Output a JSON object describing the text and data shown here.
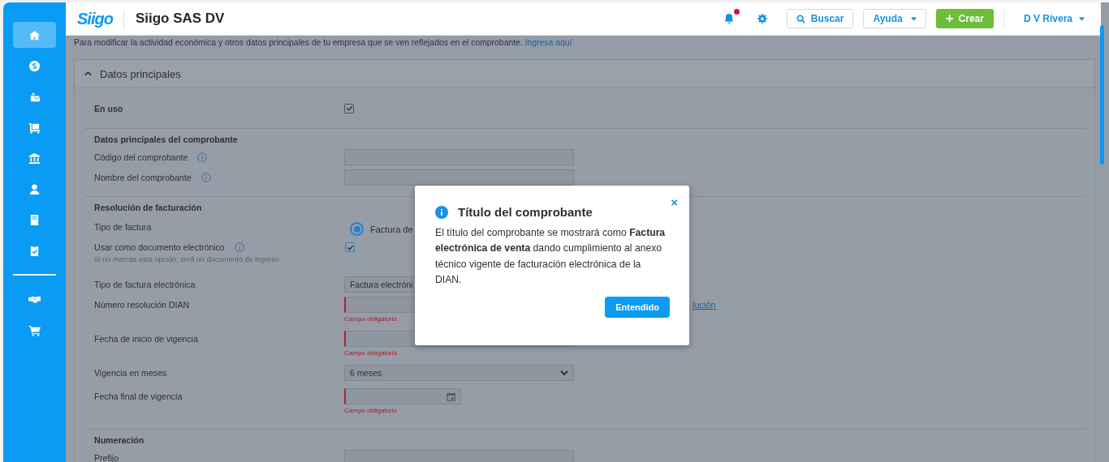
{
  "header": {
    "logo": "Siigo",
    "company": "Siigo SAS DV",
    "notifications": {
      "unread": true
    },
    "search_button": "Buscar",
    "help_button": "Ayuda",
    "create_button": "Crear",
    "create_icon": "+",
    "user": "D V Rivera"
  },
  "sidebar": {
    "main_items": [
      {
        "kind": "home",
        "selected": true
      },
      {
        "kind": "money",
        "selected": false
      },
      {
        "kind": "briefcase",
        "selected": false
      },
      {
        "kind": "dolly",
        "selected": false
      },
      {
        "kind": "bank",
        "selected": false
      },
      {
        "kind": "user",
        "selected": false
      },
      {
        "kind": "book",
        "selected": false
      },
      {
        "kind": "clipboard",
        "selected": false
      }
    ],
    "extra_items": [
      {
        "kind": "handshake",
        "selected": false
      },
      {
        "kind": "cart",
        "selected": false
      }
    ]
  },
  "notice": {
    "text": "Para modificar la actividad económica y otros datos principales de tu empresa que se ven reflejados en el comprobante.",
    "link": "Ingresa aquí"
  },
  "panel": {
    "title": "Datos principales",
    "expanded": true,
    "in_use": {
      "label": "En uso",
      "checked": true
    },
    "sections": [
      {
        "title": "Datos principales del comprobante",
        "rows": [
          {
            "kind": "input",
            "label": "Código del comprobante",
            "info": true
          },
          {
            "kind": "input",
            "label": "Nombre del comprobante",
            "info": true
          }
        ]
      },
      {
        "title": "Resolución de facturación",
        "rows": [
          {
            "kind": "radio",
            "label": "Tipo de factura",
            "option": "Factura de",
            "selected": true
          },
          {
            "kind": "checkbox",
            "label": "Usar como documento electrónico",
            "info": true,
            "hint": "Si no marcas esta opción, será un documento de ingreso",
            "checked": true
          },
          {
            "kind": "select",
            "label": "Tipo de factura electrónica",
            "value": "Factura electróni"
          },
          {
            "kind": "input",
            "label": "Número resolución DIAN",
            "error": "Campo obligatorio",
            "link": "lución"
          },
          {
            "kind": "input",
            "label": "Fecha de inicio de vigencia",
            "error": "Campo obligatorio"
          },
          {
            "kind": "select",
            "label": "Vigencia en meses",
            "value": "6 meses"
          },
          {
            "kind": "date",
            "label": "Fecha final de vigencia",
            "error": "Campo obligatorio"
          }
        ]
      },
      {
        "title": "Numeración",
        "rows": [
          {
            "kind": "input",
            "label": "Prefijo"
          }
        ]
      }
    ]
  },
  "modal": {
    "title": "Título del comprobante",
    "body": "El título del comprobante se mostrará como **Factura electrónica de venta** dando cumplimiento al anexo técnico vigente de facturación electrónica de la DIAN.",
    "button": "Entendido",
    "close": "×"
  }
}
